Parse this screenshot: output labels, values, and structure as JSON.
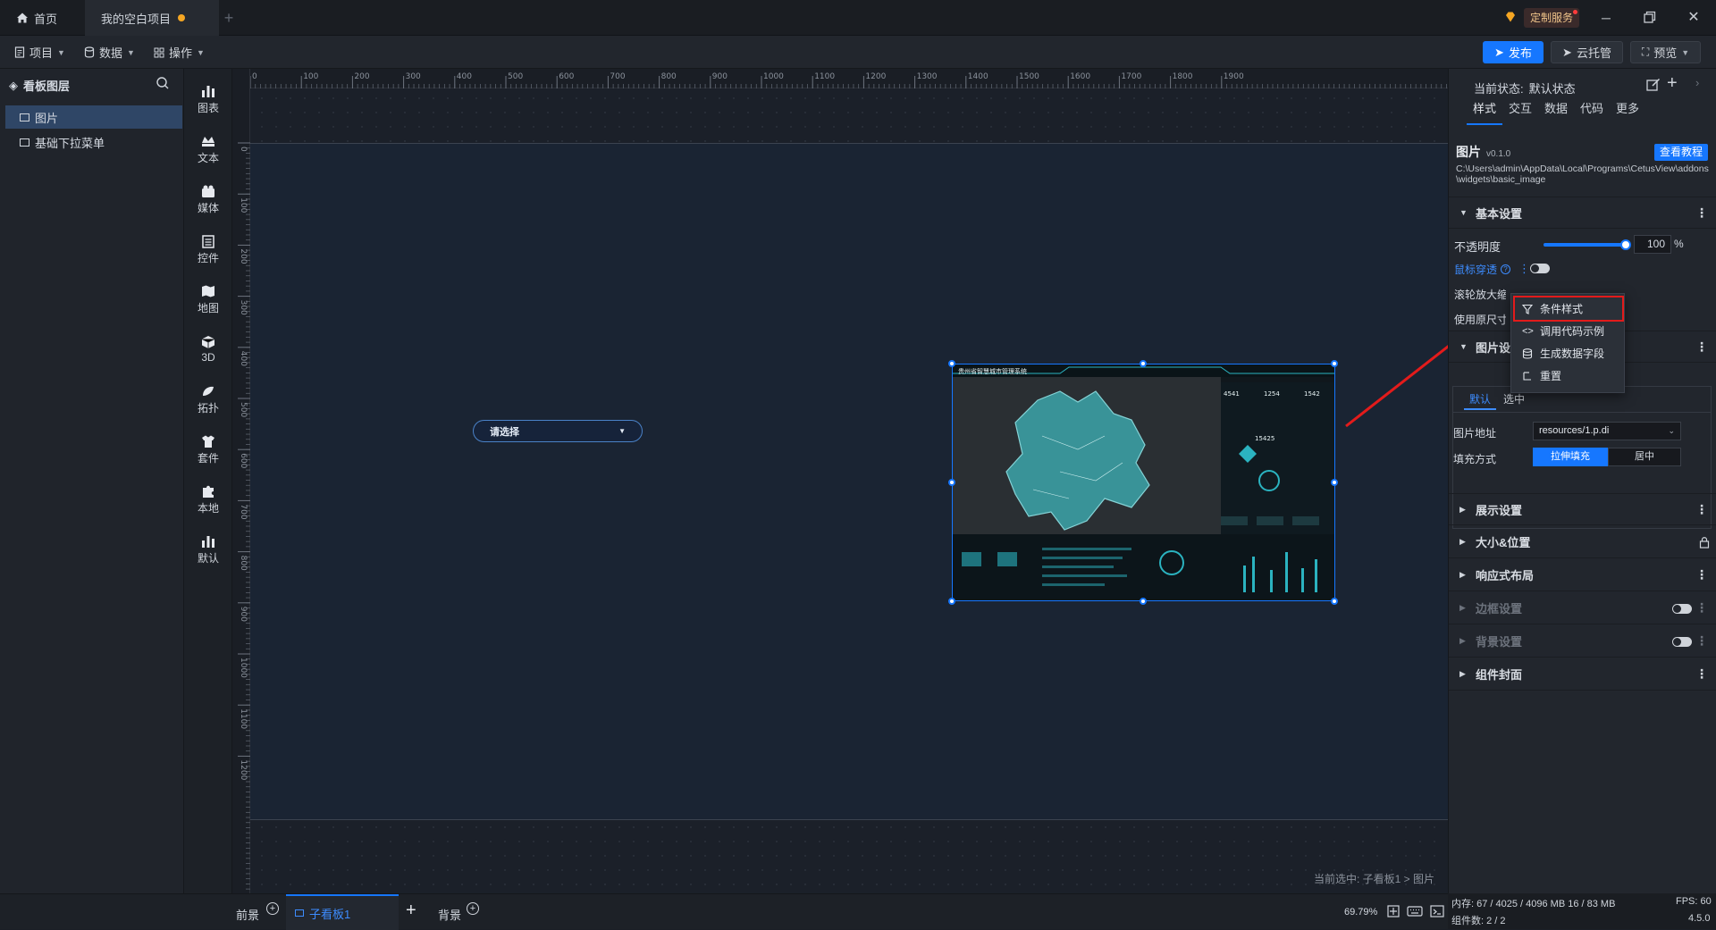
{
  "titlebar": {
    "tabs": [
      {
        "label": "首页"
      },
      {
        "label": "我的空白项目"
      }
    ],
    "custom_service": "定制服务",
    "window_buttons": [
      "minimize-icon",
      "restore-icon",
      "close-icon"
    ]
  },
  "toolbar": {
    "menus": [
      {
        "label": "项目"
      },
      {
        "label": "数据"
      },
      {
        "label": "操作"
      }
    ],
    "publish": "发布",
    "cloud": "云托管",
    "preview": "预览"
  },
  "layers": {
    "title": "看板图层",
    "items": [
      {
        "label": "图片"
      },
      {
        "label": "基础下拉菜单"
      }
    ]
  },
  "library": {
    "items": [
      {
        "label": "图表",
        "icon": "chart-icon"
      },
      {
        "label": "文本",
        "icon": "text-icon"
      },
      {
        "label": "媒体",
        "icon": "media-icon"
      },
      {
        "label": "控件",
        "icon": "control-icon"
      },
      {
        "label": "地图",
        "icon": "map-icon"
      },
      {
        "label": "3D",
        "icon": "cube-icon"
      },
      {
        "label": "拓扑",
        "icon": "topology-icon"
      },
      {
        "label": "套件",
        "icon": "suite-icon"
      },
      {
        "label": "本地",
        "icon": "puzzle-icon"
      },
      {
        "label": "默认",
        "icon": "default-icon"
      }
    ]
  },
  "ruler": {
    "h_ticks": [
      "0",
      "100",
      "200",
      "300",
      "400",
      "500",
      "600",
      "700",
      "800",
      "900",
      "1000",
      "1100",
      "1200",
      "1300",
      "1400",
      "1500",
      "1600",
      "1700",
      "1800",
      "1900"
    ],
    "v_ticks": [
      "0",
      "100",
      "200",
      "300",
      "400",
      "500",
      "600",
      "700",
      "800",
      "900",
      "1000",
      "1100",
      "1200"
    ]
  },
  "canvas": {
    "dropdown_placeholder": "请选择",
    "breadcrumb": "当前选中: 子看板1 > 图片",
    "preview_texts": {
      "banner": "贵州省智慧城市管理系统",
      "stats": [
        "4541",
        "1254",
        "1542"
      ],
      "big": "15425"
    }
  },
  "rpanel": {
    "state_label": "当前状态:",
    "state_value": "默认状态",
    "tabs": [
      {
        "label": "样式"
      },
      {
        "label": "交互"
      },
      {
        "label": "数据"
      },
      {
        "label": "代码"
      },
      {
        "label": "更多"
      }
    ],
    "widget_name": "图片",
    "widget_version": "v0.1.0",
    "tutorial": "查看教程",
    "path": "C:\\Users\\admin\\AppData\\Local\\Programs\\CetusView\\addons\\widgets\\basic_image",
    "basic_section": "基本设置",
    "opacity_label": "不透明度",
    "opacity_value": "100",
    "opacity_unit": "%",
    "opacity_fraction": 1.0,
    "mouse_through": "鼠标穿透",
    "wheel_zoom": "滚轮放大缩小",
    "use_original": "使用原尺寸",
    "image_section": "图片设置",
    "subtabs": [
      {
        "label": "默认"
      },
      {
        "label": "选中"
      }
    ],
    "image_url_label": "图片地址",
    "image_url_value": "resources/1.p.di",
    "fill_label": "填充方式",
    "fill_options": [
      {
        "label": "拉伸填充"
      },
      {
        "label": "居中"
      }
    ],
    "sections": [
      {
        "label": "展示设置"
      },
      {
        "label": "大小&位置"
      },
      {
        "label": "响应式布局"
      },
      {
        "label": "边框设置"
      },
      {
        "label": "背景设置"
      },
      {
        "label": "组件封面"
      }
    ]
  },
  "context_menu": {
    "items": [
      {
        "label": "条件样式",
        "icon": "filter-icon"
      },
      {
        "label": "调用代码示例",
        "icon": "code-icon"
      },
      {
        "label": "生成数据字段",
        "icon": "database-icon"
      },
      {
        "label": "重置",
        "icon": "reset-icon"
      }
    ]
  },
  "bottom": {
    "foreground": "前景",
    "board_tab": "子看板1",
    "background": "背景",
    "zoom": "69.79%"
  },
  "status": {
    "memory": "内存: 67 / 4025 / 4096 MB 16 / 83 MB",
    "fps": "FPS: 60",
    "widget_count": "组件数: 2 / 2",
    "version": "4.5.0"
  },
  "colors": {
    "accent": "#1677ff",
    "highlight_red": "#e31b1b",
    "unsaved_dot": "#f5a623"
  }
}
